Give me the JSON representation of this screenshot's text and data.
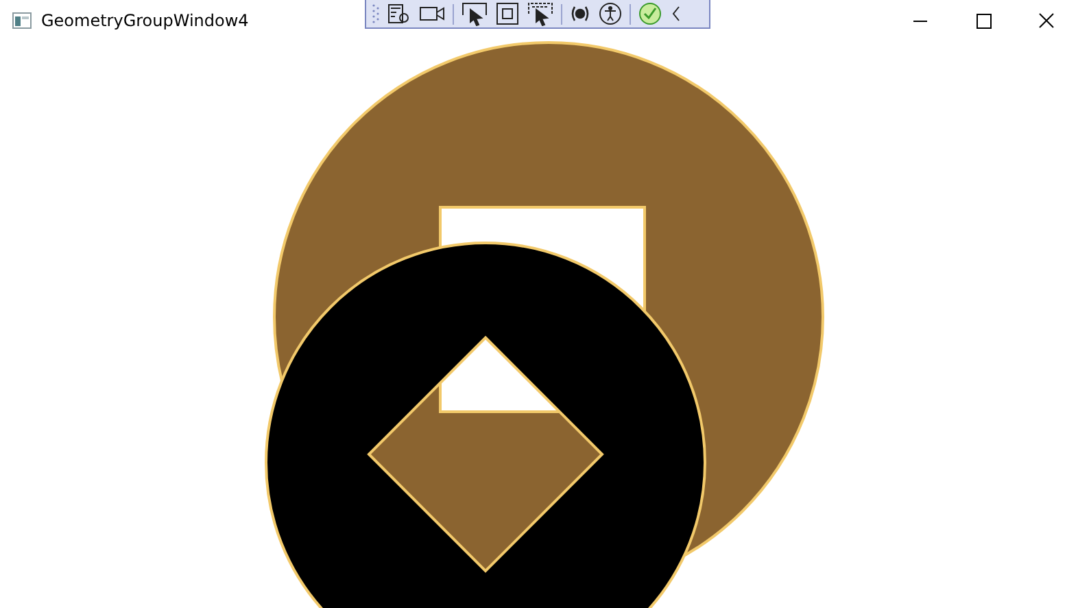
{
  "window": {
    "title": "GeometryGroupWindow4"
  }
}
